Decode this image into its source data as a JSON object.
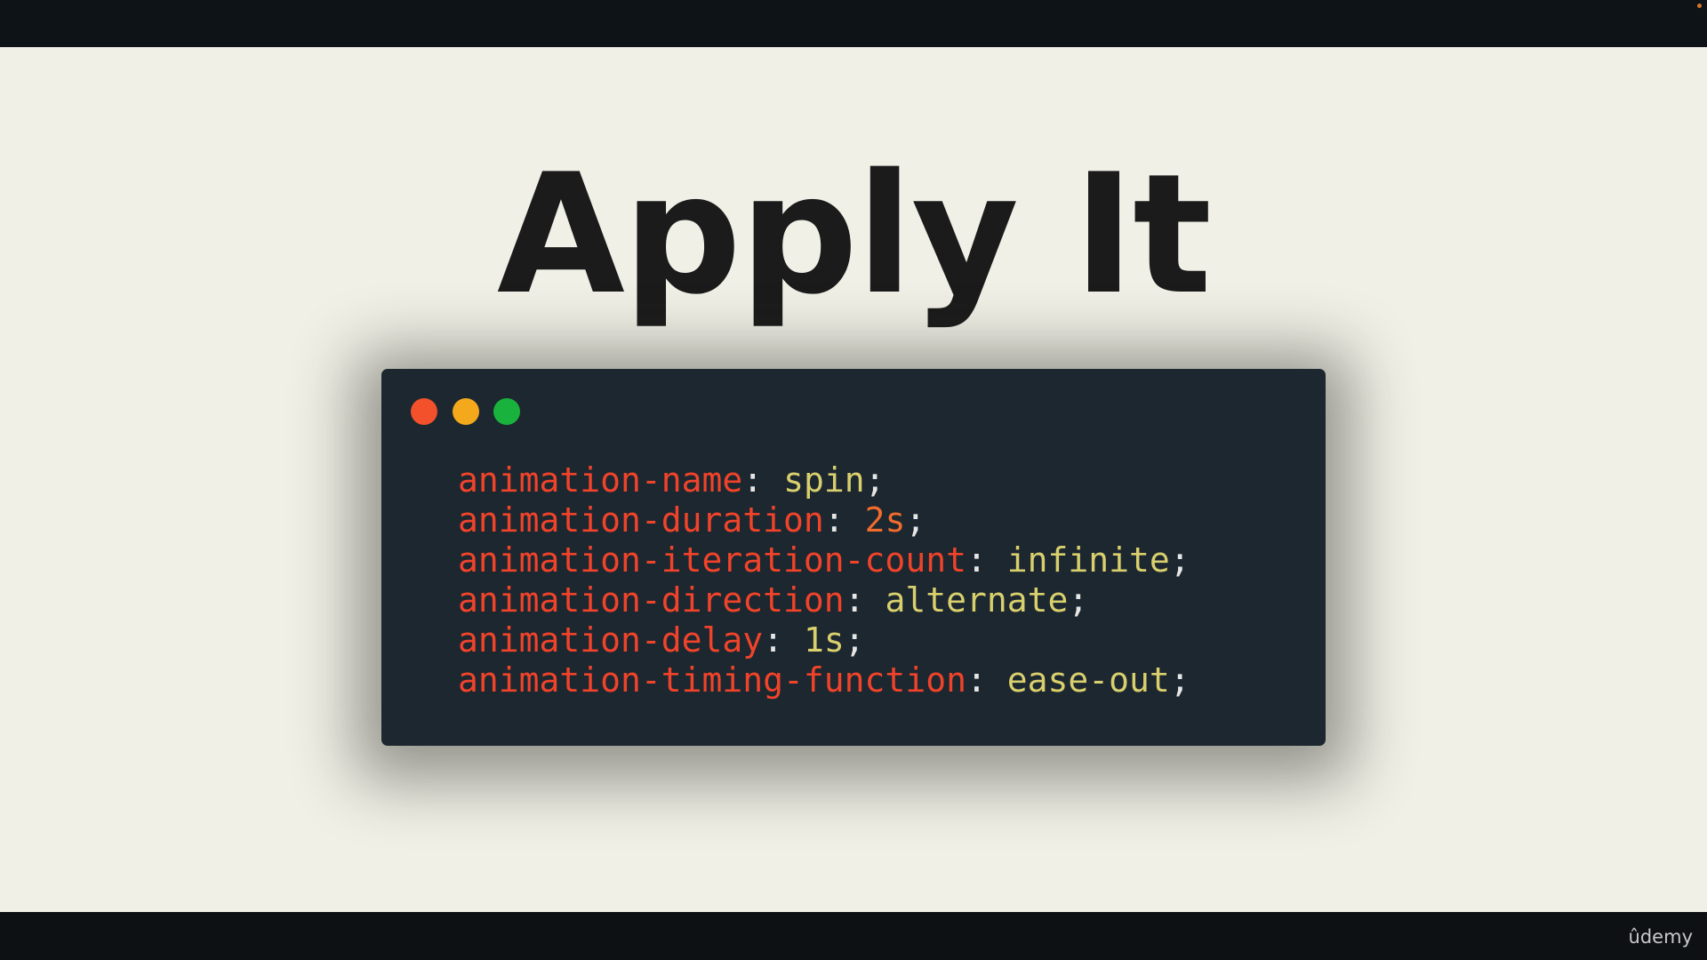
{
  "player": {
    "brand": "ûdemy"
  },
  "slide": {
    "title": "Apply It",
    "window_controls": [
      "close-dot",
      "minimize-dot",
      "maximize-dot"
    ],
    "code_lines": [
      {
        "property": "animation-name",
        "value": "spin",
        "value_kind": "keyword"
      },
      {
        "property": "animation-duration",
        "value": "2s",
        "value_kind": "number"
      },
      {
        "property": "animation-iteration-count",
        "value": "infinite",
        "value_kind": "keyword"
      },
      {
        "property": "animation-direction",
        "value": "alternate",
        "value_kind": "keyword"
      },
      {
        "property": "animation-delay",
        "value": "1s",
        "value_kind": "keyword"
      },
      {
        "property": "animation-timing-function",
        "value": "ease-out",
        "value_kind": "keyword"
      }
    ]
  },
  "colors": {
    "slide_background": "#f0f0e6",
    "code_background": "#1c2730",
    "property": "#f0432a",
    "keyword_value": "#d9cf6d",
    "number_value": "#f06b2c",
    "dot_red": "#f2512b",
    "dot_yellow": "#f4a81c",
    "dot_green": "#19b23c"
  }
}
